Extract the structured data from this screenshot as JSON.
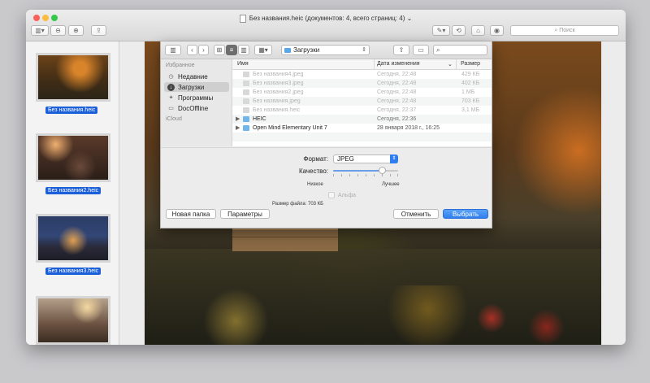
{
  "window": {
    "title": "Без названия.heic (документов: 4, всего страниц: 4)",
    "search_placeholder": "Поиск"
  },
  "thumbnails": [
    {
      "label": "Без названия.heic"
    },
    {
      "label": "Без названия2.heic"
    },
    {
      "label": "Без названия3.heic"
    },
    {
      "label": ""
    }
  ],
  "dialog": {
    "location": "Загрузки",
    "sidebar": {
      "favorites_header": "Избранное",
      "items": [
        {
          "label": "Недавние",
          "icon": "clock-icon"
        },
        {
          "label": "Загрузки",
          "icon": "downloads-icon"
        },
        {
          "label": "Программы",
          "icon": "apps-icon"
        },
        {
          "label": "DocOffline",
          "icon": "folder-icon"
        }
      ],
      "icloud_header": "iCloud"
    },
    "columns": {
      "name": "Имя",
      "date": "Дата изменения",
      "size": "Размер"
    },
    "files": [
      {
        "name": "Без названия4.jpeg",
        "date": "Сегодня, 22:48",
        "size": "429 КБ",
        "folder": false
      },
      {
        "name": "Без названия3.jpeg",
        "date": "Сегодня, 22:48",
        "size": "402 КБ",
        "folder": false
      },
      {
        "name": "Без названия2.jpeg",
        "date": "Сегодня, 22:48",
        "size": "1 МБ",
        "folder": false
      },
      {
        "name": "Без названия.jpeg",
        "date": "Сегодня, 22:48",
        "size": "703 КБ",
        "folder": false
      },
      {
        "name": "Без названия.heic",
        "date": "Сегодня, 22:37",
        "size": "3,1 МБ",
        "folder": false
      },
      {
        "name": "HEIC",
        "date": "Сегодня, 22:36",
        "size": "",
        "folder": true
      },
      {
        "name": "Open Mind Elementary Unit 7",
        "date": "28 января 2018 г., 16:25",
        "size": "",
        "folder": true
      }
    ],
    "format_label": "Формат:",
    "format_value": "JPEG",
    "quality_label": "Качество:",
    "quality_level": 0.75,
    "quality_low": "Низкое",
    "quality_high": "Лучшее",
    "alpha_label": "Альфа",
    "filesize_label": "Размер файла:",
    "filesize_value": "703 КБ",
    "new_folder": "Новая папка",
    "parameters": "Параметры",
    "cancel": "Отменить",
    "choose": "Выбрать"
  },
  "colors": {
    "accent": "#2f7ef0",
    "selection": "#1b60d8"
  }
}
